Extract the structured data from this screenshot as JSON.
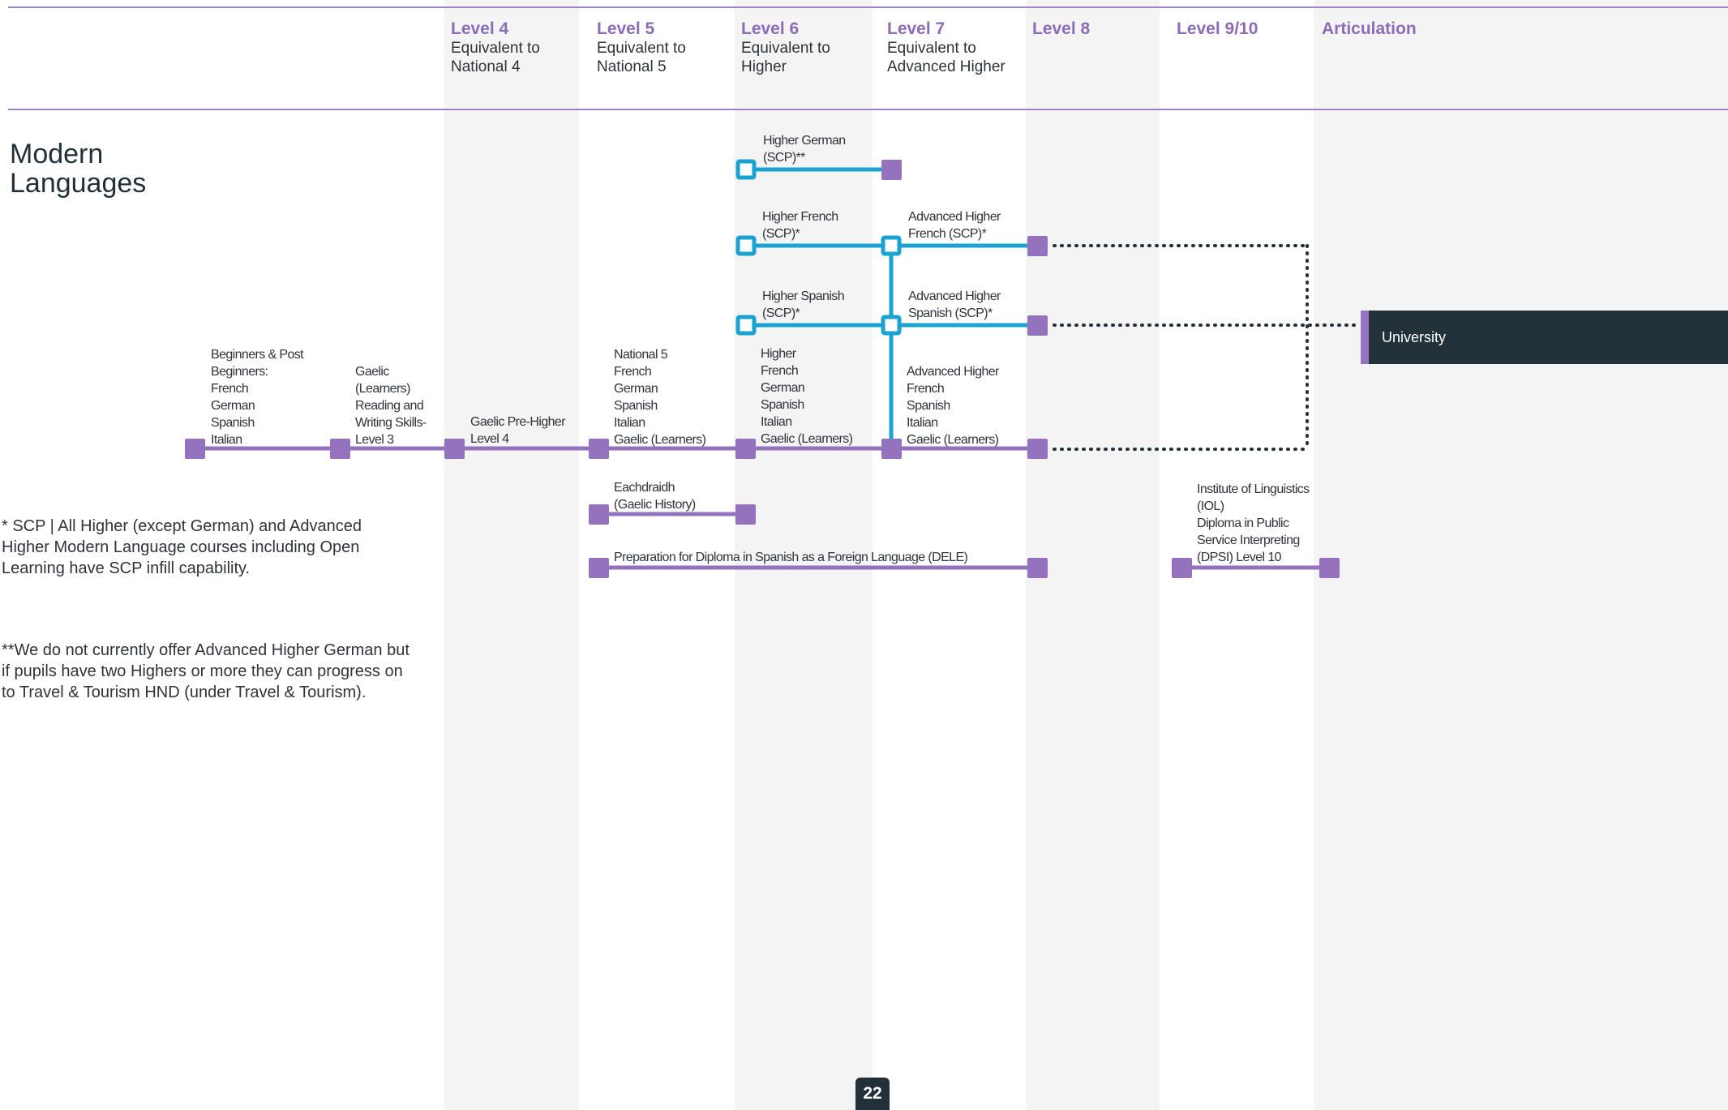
{
  "colors": {
    "accent": "#8b6cb8",
    "node": "#9572be",
    "scp": "#1aa3d1",
    "dark": "#23313a"
  },
  "levels": [
    {
      "name": "Level 4",
      "sub": "Equivalent to\nNational 4"
    },
    {
      "name": "Level 5",
      "sub": "Equivalent to\nNational 5"
    },
    {
      "name": "Level 6",
      "sub": "Equivalent to\nHigher"
    },
    {
      "name": "Level 7",
      "sub": "Equivalent to\nAdvanced Higher"
    },
    {
      "name": "Level 8",
      "sub": ""
    },
    {
      "name": "Level 9/10",
      "sub": ""
    },
    {
      "name": "Articulation",
      "sub": ""
    }
  ],
  "title": "Modern\nLanguages",
  "labels": {
    "higher_german": "Higher German\n(SCP)**",
    "higher_french": "Higher French\n(SCP)*",
    "adv_french": "Advanced Higher\nFrench (SCP)*",
    "higher_spanish": "Higher Spanish\n(SCP)*",
    "adv_spanish": "Advanced Higher\nSpanish (SCP)*",
    "beginners": "Beginners & Post\nBeginners:\nFrench\nGerman\nSpanish\nItalian",
    "gaelic_learners": "Gaelic\n(Learners)\nReading and\nWriting Skills-\nLevel 3",
    "gaelic_pre_higher": "Gaelic Pre-Higher\nLevel 4",
    "national5": "National 5\nFrench\nGerman\nSpanish\nItalian\nGaelic (Learners)",
    "higher_list": "Higher\nFrench\nGerman\nSpanish\nItalian\nGaelic (Learners)",
    "adv_list": "Advanced Higher\nFrench\nSpanish\nItalian\nGaelic (Learners)",
    "eachdraidh": "Eachdraidh\n(Gaelic History)",
    "dele": "Preparation for Diploma in Spanish as a Foreign Language (DELE)",
    "iol": "Institute of Linguistics\n(IOL)\nDiploma in Public\nService Interpreting\n(DPSI) Level 10"
  },
  "university": "University",
  "notes": {
    "scp": "* SCP | All Higher (except German) and Advanced Higher Modern Language courses including Open Learning have SCP infill capability.",
    "german": "**We do not currently offer Advanced Higher German but if pupils have two Highers or more they can progress on to Travel & Tourism HND (under Travel & Tourism)."
  },
  "page_number": "22"
}
